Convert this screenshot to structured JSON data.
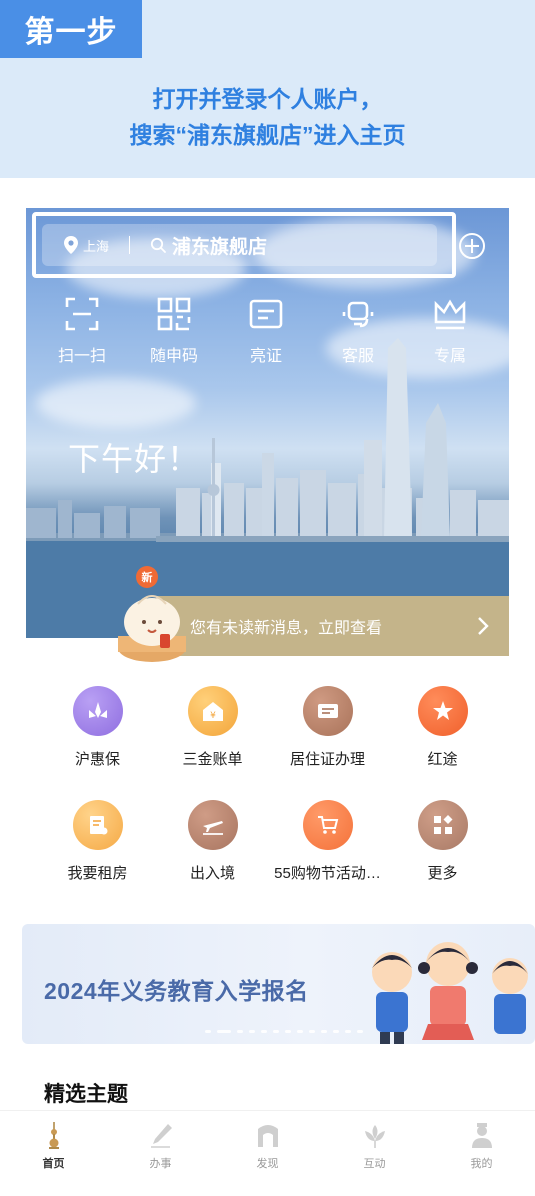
{
  "instruction": {
    "step_label": "第一步",
    "line1": "打开并登录个人账户，",
    "line2": "搜索“浦东旗舰店”进入主页"
  },
  "header": {
    "location": "上海",
    "search_text": "浦东旗舰店"
  },
  "quick_actions": [
    {
      "label": "扫一扫",
      "icon": "scan-icon"
    },
    {
      "label": "随申码",
      "icon": "qr-code-icon"
    },
    {
      "label": "亮证",
      "icon": "id-card-icon"
    },
    {
      "label": "客服",
      "icon": "headset-icon"
    },
    {
      "label": "专属",
      "icon": "crown-icon"
    }
  ],
  "greeting": "下午好！",
  "notification": {
    "badge": "新",
    "text": "您有未读新消息，立即查看"
  },
  "services": [
    {
      "label": "沪惠保",
      "icon": "lotus-icon",
      "color": "#8f6ee0"
    },
    {
      "label": "三金账单",
      "icon": "yuan-house-icon",
      "color": "#f3a53a"
    },
    {
      "label": "居住证办理",
      "icon": "residence-card-icon",
      "color": "#a9735a"
    },
    {
      "label": "红途",
      "icon": "star-flag-icon",
      "color": "#f0602c"
    },
    {
      "label": "我要租房",
      "icon": "rent-house-icon",
      "color": "#f5a945"
    },
    {
      "label": "出入境",
      "icon": "plane-icon",
      "color": "#a87560"
    },
    {
      "label": "55购物节活动…",
      "icon": "cart-icon",
      "color": "#f4723a"
    },
    {
      "label": "更多",
      "icon": "grid-more-icon",
      "color": "#a97a66"
    }
  ],
  "banner": {
    "text": "2024年义务教育入学报名"
  },
  "section_title": "精选主题",
  "tabs": [
    {
      "label": "首页",
      "icon": "home-tower-icon",
      "active": true
    },
    {
      "label": "办事",
      "icon": "pen-icon",
      "active": false
    },
    {
      "label": "发现",
      "icon": "gate-icon",
      "active": false
    },
    {
      "label": "互动",
      "icon": "flower-icon",
      "active": false
    },
    {
      "label": "我的",
      "icon": "person-icon",
      "active": false
    }
  ]
}
